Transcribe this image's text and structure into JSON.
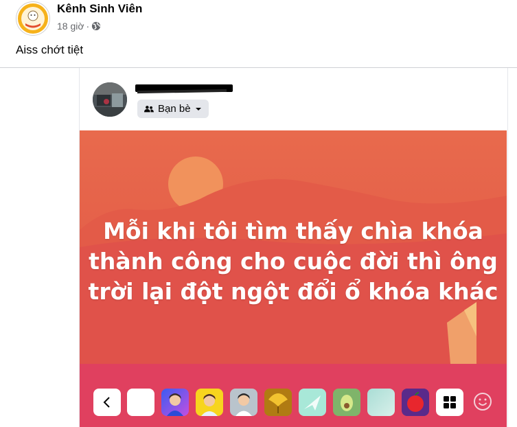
{
  "post": {
    "page_name": "Kênh Sinh Viên",
    "time": "18 giờ",
    "separator": "·",
    "text": "Aiss chớt tiệt"
  },
  "shared": {
    "audience_label": "Bạn bè",
    "banner_lines": [
      "Mỗi khi tôi tìm thấy chìa khóa",
      "thành công cho cuộc đời thì ông",
      "trời lại đột ngột đổi ổ khóa khác"
    ]
  },
  "background_picker": {
    "tiles": [
      {
        "name": "back-arrow-tile",
        "icon": "chevron-left-icon",
        "color": "#ffffff"
      },
      {
        "name": "background-option-white",
        "color": "#ffffff"
      },
      {
        "name": "background-option-avatar-blue",
        "icon": "avatar-icon",
        "color": "#4a6cf0"
      },
      {
        "name": "background-option-avatar-yellow",
        "icon": "avatar-icon",
        "color": "#f7d51e"
      },
      {
        "name": "background-option-avatar-gray",
        "icon": "avatar-icon",
        "color": "#b8c4cc"
      },
      {
        "name": "background-option-ginkgo",
        "icon": "ginkgo-leaf-icon",
        "color": "#c48a14"
      },
      {
        "name": "background-option-paper-plane",
        "icon": "paper-plane-icon",
        "color": "#a8e8d8"
      },
      {
        "name": "background-option-avocado",
        "icon": "avocado-icon",
        "color": "#7fb46a"
      },
      {
        "name": "background-option-mint",
        "color": "#a9ddd5"
      },
      {
        "name": "background-option-apple",
        "icon": "apple-icon",
        "color": "#6a2a8c"
      },
      {
        "name": "background-option-more",
        "icon": "grid-icon",
        "color": "#ffffff"
      }
    ],
    "emoji_icon": "smile-icon"
  },
  "colors": {
    "banner_base": "#e55b48",
    "sun": "#f0955f",
    "tray": "#e0405f",
    "meta_text": "#65676b"
  }
}
